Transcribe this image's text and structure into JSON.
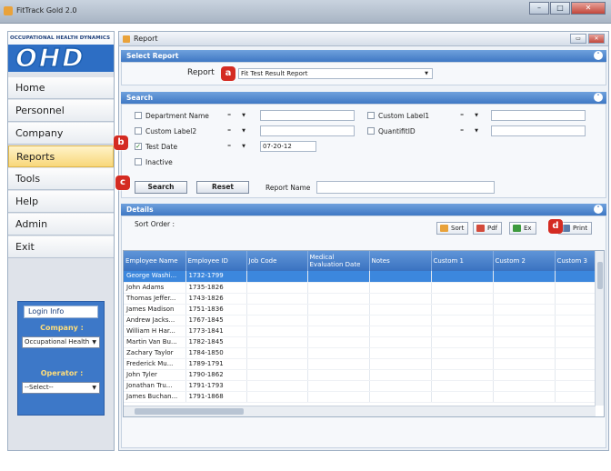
{
  "window": {
    "title": "FitTrack Gold 2.0",
    "min": "–",
    "max": "□",
    "close": "✕"
  },
  "brand": {
    "top_text": "Occupational Health Dynamics",
    "logo": "OHD"
  },
  "nav": [
    "Home",
    "Personnel",
    "Company",
    "Reports",
    "Tools",
    "Help",
    "Admin",
    "Exit"
  ],
  "login": {
    "header": "Login Info",
    "company_label": "Company :",
    "company_value": "Occupational Health",
    "operator_label": "Operator :",
    "operator_value": "--Select--"
  },
  "report_window": {
    "title": "Report"
  },
  "select_report": {
    "header": "Select Report",
    "label": "Report",
    "value": "Fit Test Result Report"
  },
  "search": {
    "header": "Search",
    "rows": [
      {
        "label": "Department Name",
        "op": "=",
        "value": "",
        "checked": false
      },
      {
        "label": "Custom Label2",
        "op": "=",
        "value": "",
        "checked": false
      },
      {
        "label": "Test Date",
        "op": "=",
        "value": "07-20-12",
        "checked": true
      },
      {
        "label": "Inactive",
        "checked": false
      }
    ],
    "right_rows": [
      {
        "label": "Custom Label1",
        "op": "="
      },
      {
        "label": "QuantifitID",
        "op": "="
      }
    ],
    "search_button": "Search",
    "reset_button": "Reset",
    "report_name_label": "Report Name"
  },
  "details": {
    "header": "Details",
    "sort_order_label": "Sort Order :",
    "toolbar": {
      "sort": "Sort",
      "pdf": "Pdf",
      "excel": "Ex",
      "print": "Print"
    },
    "columns": [
      "Employee Name",
      "Employee ID",
      "Job Code",
      "Medical Evaluation Date",
      "Notes",
      "Custom 1",
      "Custom 2",
      "Custom 3"
    ],
    "rows": [
      [
        "George  Washi...",
        "1732-1799"
      ],
      [
        "John  Adams",
        "1735-1826"
      ],
      [
        "Thomas  Jeffer...",
        "1743-1826"
      ],
      [
        "James  Madison",
        "1751-1836"
      ],
      [
        "Andrew  Jacks...",
        "1767-1845"
      ],
      [
        "William H Har...",
        "1773-1841"
      ],
      [
        "Martin  Van Bu...",
        "1782-1845"
      ],
      [
        "Zachary  Taylor",
        "1784-1850"
      ],
      [
        "Frederick  Mu...",
        "1789-1791"
      ],
      [
        "John  Tyler",
        "1790-1862"
      ],
      [
        "Jonathan  Tru...",
        "1791-1793"
      ],
      [
        "James  Buchan...",
        "1791-1868"
      ]
    ]
  },
  "markers": {
    "a": "a",
    "b": "b",
    "c": "c",
    "d": "d"
  },
  "colors": {
    "accent": "#3f78c4",
    "marker": "#d42b22",
    "selected_row": "#3c87dd"
  }
}
